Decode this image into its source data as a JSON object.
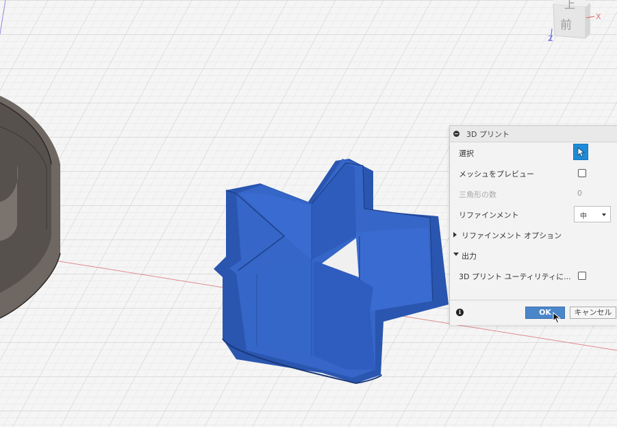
{
  "viewcube": {
    "top_face": "上",
    "front_face": "前",
    "axis_x": "X",
    "axis_z": "Z"
  },
  "panel": {
    "title": "3D プリント",
    "rows": {
      "select_label": "選択",
      "mesh_preview_label": "メッシュをプレビュー",
      "triangle_count_label": "三角形の数",
      "triangle_count_value": "0",
      "refinement_label": "リファインメント",
      "refinement_value": "中",
      "refinement_options_label": "リファインメント オプション",
      "output_label": "出力",
      "print_utility_label": "3D プリント ユーティリティに..."
    },
    "states": {
      "mesh_preview_checked": false,
      "print_utility_checked": false
    },
    "footer": {
      "info_icon_glyph": "i",
      "ok_label": "OK",
      "cancel_label": "キャンセル"
    }
  },
  "colors": {
    "accent": "#1f8ad6",
    "model_blue": "#2f5fbf",
    "ok_blue": "#4a86c8"
  }
}
